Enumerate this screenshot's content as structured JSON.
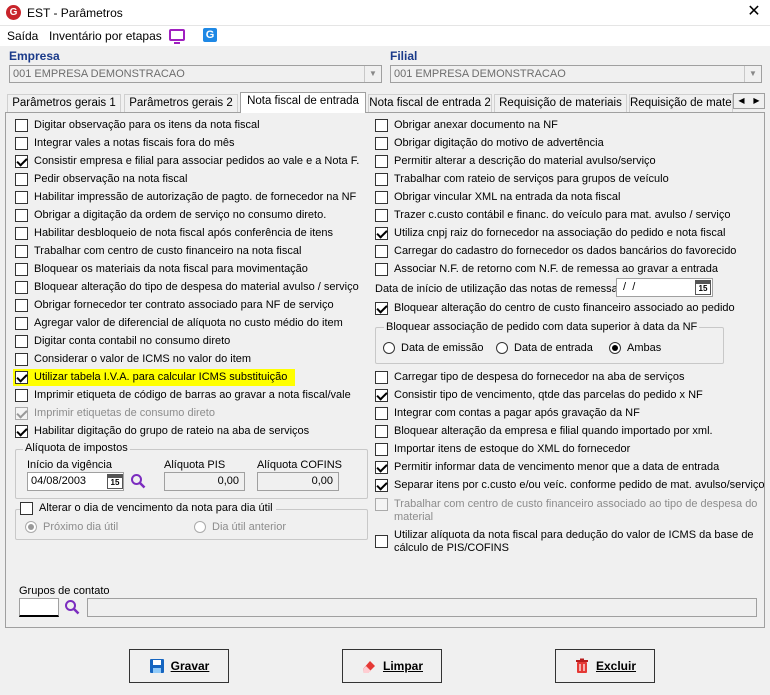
{
  "window": {
    "title": "EST - Parâmetros",
    "close": "✕",
    "app_icon_letter": "G"
  },
  "menu": {
    "saida": "Saída",
    "inventario": "Inventário por etapas",
    "g_icon_letter": "G"
  },
  "empresa": {
    "label": "Empresa",
    "value": "001 EMPRESA DEMONSTRACAO"
  },
  "filial": {
    "label": "Filial",
    "value": "001 EMPRESA DEMONSTRACAO"
  },
  "tabs": [
    {
      "label": "Parâmetros gerais 1"
    },
    {
      "label": "Parâmetros gerais 2"
    },
    {
      "label": "Nota fiscal de entrada"
    },
    {
      "label": "Nota fiscal de entrada 2"
    },
    {
      "label": "Requisição de materiais"
    },
    {
      "label": "Requisição de materi"
    }
  ],
  "tab_arrows": {
    "left": "◀",
    "right": "▶"
  },
  "left_checks": [
    {
      "label": "Digitar observação para os itens da nota fiscal",
      "checked": false
    },
    {
      "label": "Integrar vales a notas fiscais fora do mês",
      "checked": false
    },
    {
      "label": "Consistir empresa e filial para associar pedidos ao vale e a Nota F.",
      "checked": true
    },
    {
      "label": "Pedir observação na nota fiscal",
      "checked": false
    },
    {
      "label": "Habilitar impressão de autorização de pagto. de fornecedor na NF",
      "checked": false
    },
    {
      "label": "Obrigar a digitação da ordem de serviço no consumo direto.",
      "checked": false
    },
    {
      "label": "Habilitar desbloqueio de nota fiscal após conferência de itens",
      "checked": false
    },
    {
      "label": "Trabalhar com centro de custo financeiro na nota fiscal",
      "checked": false
    },
    {
      "label": "Bloquear os materiais da nota fiscal para movimentação",
      "checked": false
    },
    {
      "label": "Bloquear alteração do tipo de despesa do material avulso / serviço",
      "checked": false
    },
    {
      "label": "Obrigar fornecedor ter contrato associado para NF de serviço",
      "checked": false
    },
    {
      "label": "Agregar valor de diferencial de alíquota no custo médio do item",
      "checked": false
    },
    {
      "label": "Digitar conta contabil no consumo direto",
      "checked": false
    },
    {
      "label": "Considerar o valor de ICMS no valor do item",
      "checked": false
    },
    {
      "label": "Utilizar tabela I.V.A. para calcular ICMS substituição",
      "checked": true,
      "highlight": true
    },
    {
      "label": "Imprimir etiqueta de código de barras ao gravar a nota fiscal/vale",
      "checked": false
    },
    {
      "label": "Imprimir etiquetas de consumo direto",
      "checked": true,
      "disabled": true
    },
    {
      "label": "Habilitar digitação do grupo de rateio na aba de serviços",
      "checked": true
    }
  ],
  "aliquota": {
    "title": "Alíquota de impostos",
    "inicio_label": "Início da vigência",
    "inicio_value": "04/08/2003",
    "pis_label": "Alíquota PIS",
    "pis_value": "0,00",
    "cofins_label": "Alíquota COFINS",
    "cofins_value": "0,00",
    "cal_text": "15"
  },
  "vencimento": {
    "label": "Alterar o dia de vencimento da nota para dia útil",
    "opt1": "Próximo dia útil",
    "opt2": "Dia útil anterior"
  },
  "right_checks_top": [
    {
      "label": "Obrigar anexar documento na NF",
      "checked": false
    },
    {
      "label": "Obrigar digitação do motivo de advertência",
      "checked": false
    },
    {
      "label": "Permitir alterar a descrição do material avulso/serviço",
      "checked": false
    },
    {
      "label": "Trabalhar com rateio de serviços para grupos de veículo",
      "checked": false
    },
    {
      "label": "Obrigar vincular XML na entrada da nota fiscal",
      "checked": false
    },
    {
      "label": "Trazer c.custo contábil e financ. do veículo para mat. avulso / serviço",
      "checked": false
    },
    {
      "label": "Utiliza cnpj raiz do fornecedor na associação do pedido e nota fiscal",
      "checked": true
    },
    {
      "label": "Carregar do cadastro do fornecedor os dados bancários do favorecido",
      "checked": false
    },
    {
      "label": "Associar N.F. de retorno com N.F. de remessa ao gravar a entrada",
      "checked": false
    }
  ],
  "remessa": {
    "label": "Data de início de utilização das notas de remessa",
    "value": " /  /"
  },
  "bloquear_cc": {
    "label": "Bloquear alteração do centro de custo financeiro associado ao pedido",
    "checked": true
  },
  "bloquear_pedido": {
    "title": "Bloquear associação de pedido com data superior à data da NF",
    "opt1": "Data de emissão",
    "opt2": "Data de entrada",
    "opt3": "Ambas"
  },
  "right_checks_bottom": [
    {
      "label": "Carregar tipo de despesa do fornecedor na aba de serviços",
      "checked": false
    },
    {
      "label": "Consistir tipo de vencimento, qtde das parcelas do pedido x NF",
      "checked": true
    },
    {
      "label": "Integrar com contas a pagar após gravação da NF",
      "checked": false
    },
    {
      "label": "Bloquear alteração da empresa e filial quando importado por xml.",
      "checked": false
    },
    {
      "label": "Importar itens de estoque do XML do fornecedor",
      "checked": false
    },
    {
      "label": "Permitir informar data de vencimento menor que a data de entrada",
      "checked": true
    },
    {
      "label": "Separar itens por c.custo e/ou veíc. conforme pedido de mat. avulso/serviço",
      "checked": true
    }
  ],
  "trabalhar_cc": {
    "line1": "Trabalhar com centro de custo financeiro associado ao tipo de despesa do",
    "line2": "material"
  },
  "utilizar_aliquota": {
    "line1": "Utilizar alíquota da nota fiscal para dedução do valor de ICMS da base de",
    "line2": "cálculo de PIS/COFINS"
  },
  "grupos": {
    "label": "Grupos de contato",
    "value": ""
  },
  "buttons": {
    "gravar": "Gravar",
    "limpar": "Limpar",
    "excluir": "Excluir"
  }
}
